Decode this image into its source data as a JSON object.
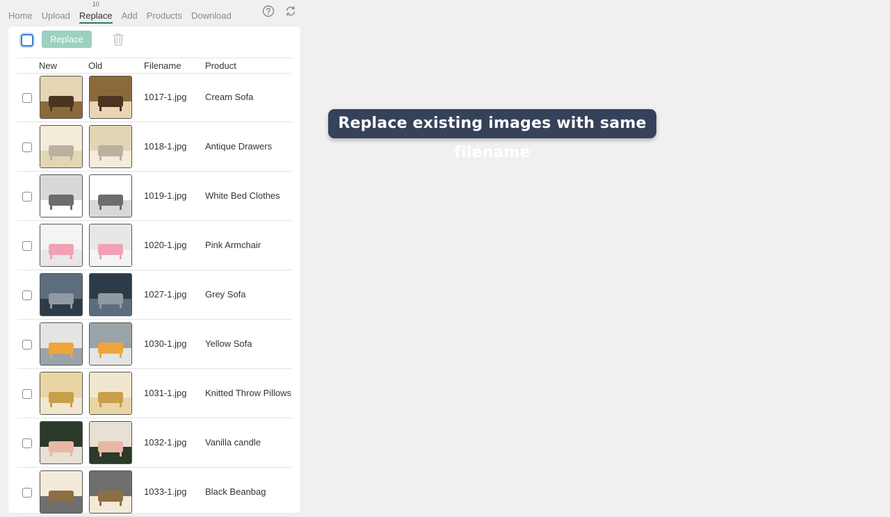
{
  "nav": {
    "tabs": [
      {
        "label": "Home"
      },
      {
        "label": "Upload"
      },
      {
        "label": "Replace",
        "badge": "10",
        "active": true
      },
      {
        "label": "Add"
      },
      {
        "label": "Products"
      },
      {
        "label": "Download"
      }
    ],
    "icons": [
      "help-icon",
      "refresh-icon"
    ]
  },
  "toolbar": {
    "replace_label": "Replace",
    "select_all_checked": false,
    "icons": [
      "trash-icon"
    ]
  },
  "table": {
    "columns": [
      "New",
      "Old",
      "Filename",
      "Product"
    ],
    "rows": [
      {
        "filename": "1017-1.jpg",
        "product": "Cream Sofa"
      },
      {
        "filename": "1018-1.jpg",
        "product": "Antique Drawers"
      },
      {
        "filename": "1019-1.jpg",
        "product": "White Bed Clothes"
      },
      {
        "filename": "1020-1.jpg",
        "product": "Pink Armchair"
      },
      {
        "filename": "1027-1.jpg",
        "product": "Grey Sofa"
      },
      {
        "filename": "1030-1.jpg",
        "product": "Yellow Sofa"
      },
      {
        "filename": "1031-1.jpg",
        "product": "Knitted Throw Pillows"
      },
      {
        "filename": "1032-1.jpg",
        "product": "Vanilla candle"
      },
      {
        "filename": "1033-1.jpg",
        "product": "Black Beanbag"
      }
    ]
  },
  "caption": "Replace existing images with same filename",
  "colors": {
    "accent": "#2e7d57",
    "button": "#9dd0c0",
    "caption_bg": "#36425a",
    "focus": "#3a7bd5"
  }
}
